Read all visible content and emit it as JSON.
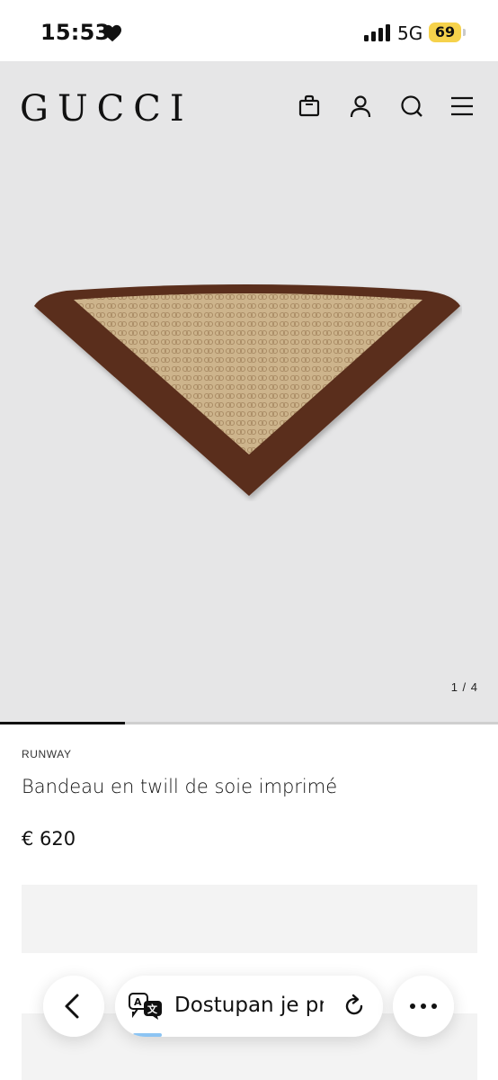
{
  "status_bar": {
    "time": "15:53",
    "network": "5G",
    "battery": "69",
    "battery_color": "#f6d24b"
  },
  "header": {
    "brand": "GUCCI",
    "icons": [
      "shopping-bag-icon",
      "user-icon",
      "search-icon",
      "menu-icon"
    ]
  },
  "gallery": {
    "pager": "1 / 4",
    "progress_fraction": 0.25
  },
  "product": {
    "label": "RUNWAY",
    "name": "Bandeau en twill de soie imprimé",
    "price": "€ 620",
    "colors": {
      "border": "#5a2f1c",
      "fabric": "#cdb48c"
    }
  },
  "browser_toolbar": {
    "address_text": "Dostupan je prij",
    "icons": [
      "back-chevron-icon",
      "translate-icon",
      "reload-icon",
      "more-dots-icon"
    ]
  }
}
